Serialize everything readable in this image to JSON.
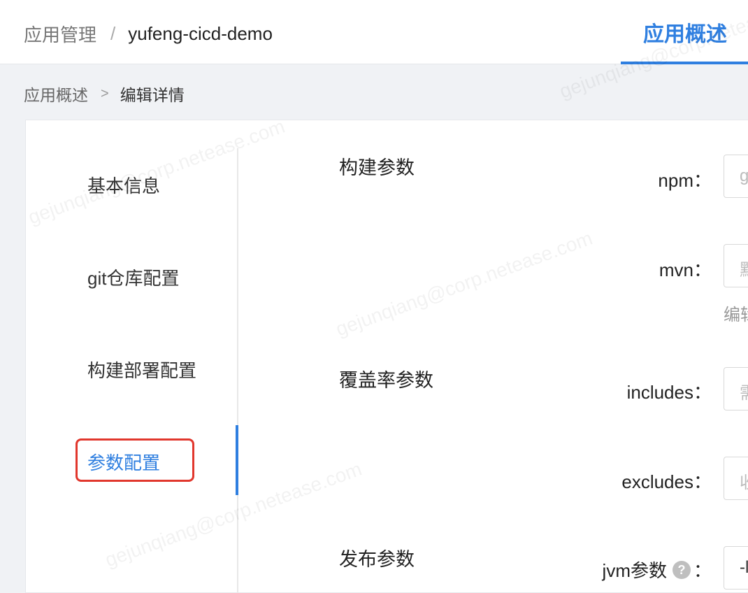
{
  "header": {
    "breadcrumb_parent": "应用管理",
    "breadcrumb_separator": "/",
    "breadcrumb_current": "yufeng-cicd-demo",
    "active_tab": "应用概述"
  },
  "sub_breadcrumb": {
    "link": "应用概述",
    "arrow": ">",
    "current": "编辑详情"
  },
  "side_nav": {
    "items": [
      {
        "label": "基本信息"
      },
      {
        "label": "git仓库配置"
      },
      {
        "label": "构建部署配置"
      },
      {
        "label": "参数配置"
      }
    ],
    "active_index": 3
  },
  "sections": {
    "build": {
      "title": "构建参数",
      "npm_label": "npm",
      "npm_placeholder": "g",
      "mvn_label": "mvn",
      "mvn_placeholder": "默",
      "mvn_help": "编辑"
    },
    "coverage": {
      "title": "覆盖率参数",
      "includes_label": "includes",
      "includes_placeholder": "需",
      "excludes_label": "excludes",
      "excludes_placeholder": "收"
    },
    "release": {
      "title": "发布参数",
      "jvm_label": "jvm参数",
      "jvm_help_icon": "?",
      "jvm_value": "-l"
    },
    "colon": "："
  },
  "watermark": "gejunqiang@corp.netease.com",
  "colors": {
    "accent": "#2f7fe0",
    "highlight_box": "#e1372d"
  }
}
